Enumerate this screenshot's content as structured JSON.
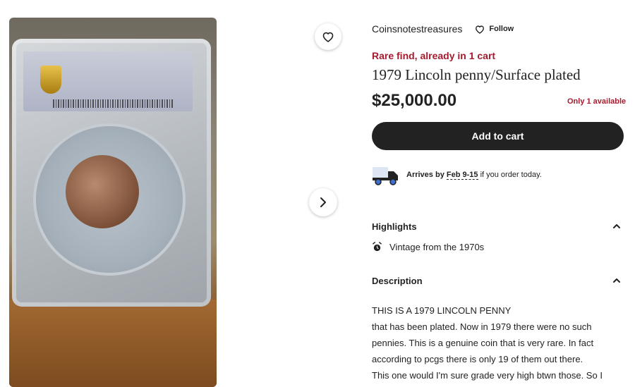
{
  "gallery": {
    "favorite_icon": "heart-outline-icon",
    "next_icon": "chevron-right-icon",
    "image_alt": "1979 Lincoln penny in PCGS holder"
  },
  "shop": {
    "name": "Coinsnotestreasures",
    "follow_label": "Follow"
  },
  "listing": {
    "urgency": "Rare find, already in 1 cart",
    "title": "1979 Lincoln penny/Surface plated",
    "price": "$25,000.00",
    "availability": "Only 1 available",
    "add_to_cart_label": "Add to cart"
  },
  "shipping": {
    "arrives_prefix": "Arrives by",
    "dates": "Feb 9-15",
    "suffix": "if you order today."
  },
  "highlights": {
    "heading": "Highlights",
    "items": [
      {
        "icon": "alarm-clock-icon",
        "label": "Vintage from the 1970s"
      }
    ]
  },
  "description": {
    "heading": "Description",
    "lines": [
      "THIS IS A 1979 LINCOLN PENNY",
      "that has been plated. Now in 1979 there were no such",
      "pennies. This is a genuine coin that is very rare. In fact",
      "according to pcgs there is only 19 of them out there.",
      "This one would I'm sure grade very high btwn those. So I"
    ]
  },
  "colors": {
    "accent_red": "#a61a2e",
    "button_dark": "#222222",
    "text": "#222222"
  }
}
